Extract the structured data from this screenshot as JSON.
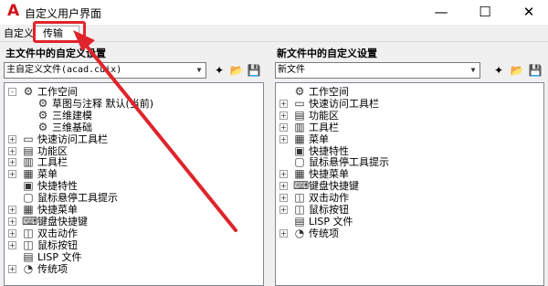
{
  "window": {
    "title": "自定义用户界面",
    "logo_letter": "A",
    "minimize_glyph": "—",
    "maximize_glyph": "☐",
    "close_glyph": "✕"
  },
  "tabs": [
    {
      "label": "自定义"
    },
    {
      "label": "传输"
    }
  ],
  "left_panel": {
    "header": "主文件中的自定义设置",
    "file_value": "主自定义文件(acad.cuix)",
    "items": [
      {
        "label": "工作空间",
        "icon": "gear-icon",
        "glyph": "⚙"
      },
      {
        "label": "草图与注释 默认(当前)",
        "icon": "gear-icon",
        "glyph": "⚙"
      },
      {
        "label": "三维建模",
        "icon": "gear-icon",
        "glyph": "⚙"
      },
      {
        "label": "三维基础",
        "icon": "gear-icon",
        "glyph": "⚙"
      },
      {
        "label": "快速访问工具栏",
        "icon": "toolbar-icon",
        "glyph": "▭"
      },
      {
        "label": "功能区",
        "icon": "ribbon-icon",
        "glyph": "▤"
      },
      {
        "label": "工具栏",
        "icon": "toolbar-icon",
        "glyph": "▥"
      },
      {
        "label": "菜单",
        "icon": "menu-icon",
        "glyph": "▦"
      },
      {
        "label": "快捷特性",
        "icon": "quick-properties-icon",
        "glyph": "▣"
      },
      {
        "label": "鼠标悬停工具提示",
        "icon": "tooltip-icon",
        "glyph": "▢"
      },
      {
        "label": "快捷菜单",
        "icon": "shortcut-menu-icon",
        "glyph": "▦"
      },
      {
        "label": "键盘快捷键",
        "icon": "keyboard-icon",
        "glyph": "⌨"
      },
      {
        "label": "双击动作",
        "icon": "double-click-icon",
        "glyph": "◫"
      },
      {
        "label": "鼠标按钮",
        "icon": "mouse-icon",
        "glyph": "◫"
      },
      {
        "label": "LISP 文件",
        "icon": "lisp-file-icon",
        "glyph": "▤"
      },
      {
        "label": "传统项",
        "icon": "legacy-icon",
        "glyph": "◔"
      }
    ]
  },
  "right_panel": {
    "header": "新文件中的自定义设置",
    "file_value": "新文件",
    "items": [
      {
        "label": "工作空间",
        "icon": "gear-icon",
        "glyph": "⚙"
      },
      {
        "label": "快速访问工具栏",
        "icon": "toolbar-icon",
        "glyph": "▭"
      },
      {
        "label": "功能区",
        "icon": "ribbon-icon",
        "glyph": "▤"
      },
      {
        "label": "工具栏",
        "icon": "toolbar-icon",
        "glyph": "▥"
      },
      {
        "label": "菜单",
        "icon": "menu-icon",
        "glyph": "▦"
      },
      {
        "label": "快捷特性",
        "icon": "quick-properties-icon",
        "glyph": "▣"
      },
      {
        "label": "鼠标悬停工具提示",
        "icon": "tooltip-icon",
        "glyph": "▢"
      },
      {
        "label": "快捷菜单",
        "icon": "shortcut-menu-icon",
        "glyph": "▦"
      },
      {
        "label": "键盘快捷键",
        "icon": "keyboard-icon",
        "glyph": "⌨"
      },
      {
        "label": "双击动作",
        "icon": "double-click-icon",
        "glyph": "◫"
      },
      {
        "label": "鼠标按钮",
        "icon": "mouse-icon",
        "glyph": "◫"
      },
      {
        "label": "LISP 文件",
        "icon": "lisp-file-icon",
        "glyph": "▤"
      },
      {
        "label": "传统项",
        "icon": "legacy-icon",
        "glyph": "◔"
      }
    ]
  },
  "toolbar_icons": {
    "new": "✦",
    "open": "📂",
    "save": "💾"
  },
  "colors": {
    "annotation_red": "#e0242b",
    "logo_red": "#d0121b"
  }
}
